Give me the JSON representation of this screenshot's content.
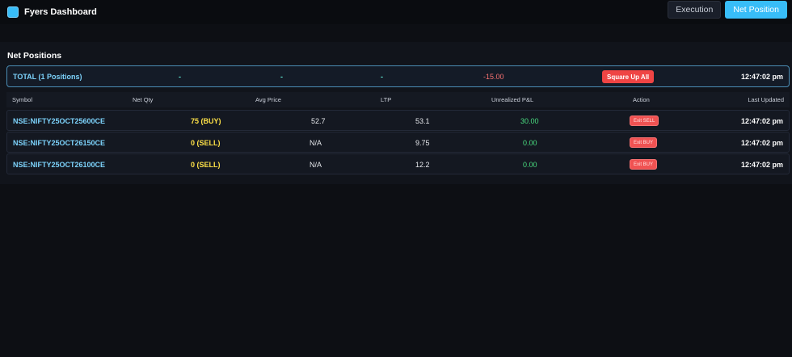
{
  "header": {
    "title": "Fyers Dashboard",
    "nav": [
      {
        "label": "Execution",
        "active": false
      },
      {
        "label": "Net Position",
        "active": true
      }
    ]
  },
  "section": {
    "title": "Net Positions"
  },
  "total": {
    "label": "TOTAL (1 Positions)",
    "net_qty": "-",
    "avg_price": "-",
    "ltp": "-",
    "pnl": "-15.00",
    "action_label": "Square Up All",
    "time": "12:47:02 pm"
  },
  "columns": [
    "Symbol",
    "Net Qty",
    "Avg Price",
    "LTP",
    "Unrealized P&L",
    "Action",
    "Last Updated"
  ],
  "rows": [
    {
      "symbol": "NSE:NIFTY25OCT25600CE",
      "qty": "75 (BUY)",
      "avg": "52.7",
      "ltp": "53.1",
      "pnl": "30.00",
      "action": "Exit SELL",
      "time": "12:47:02 pm"
    },
    {
      "symbol": "NSE:NIFTY25OCT26150CE",
      "qty": "0 (SELL)",
      "avg": "N/A",
      "ltp": "9.75",
      "pnl": "0.00",
      "action": "Exit BUY",
      "time": "12:47:02 pm"
    },
    {
      "symbol": "NSE:NIFTY25OCT26100CE",
      "qty": "0 (SELL)",
      "avg": "N/A",
      "ltp": "12.2",
      "pnl": "0.00",
      "action": "Exit BUY",
      "time": "12:47:02 pm"
    }
  ],
  "colors": {
    "accent": "#38bdf8",
    "profit": "#4ade80",
    "loss": "#f87171",
    "buy_qty": "#fde047",
    "danger_button": "#ef4444"
  }
}
